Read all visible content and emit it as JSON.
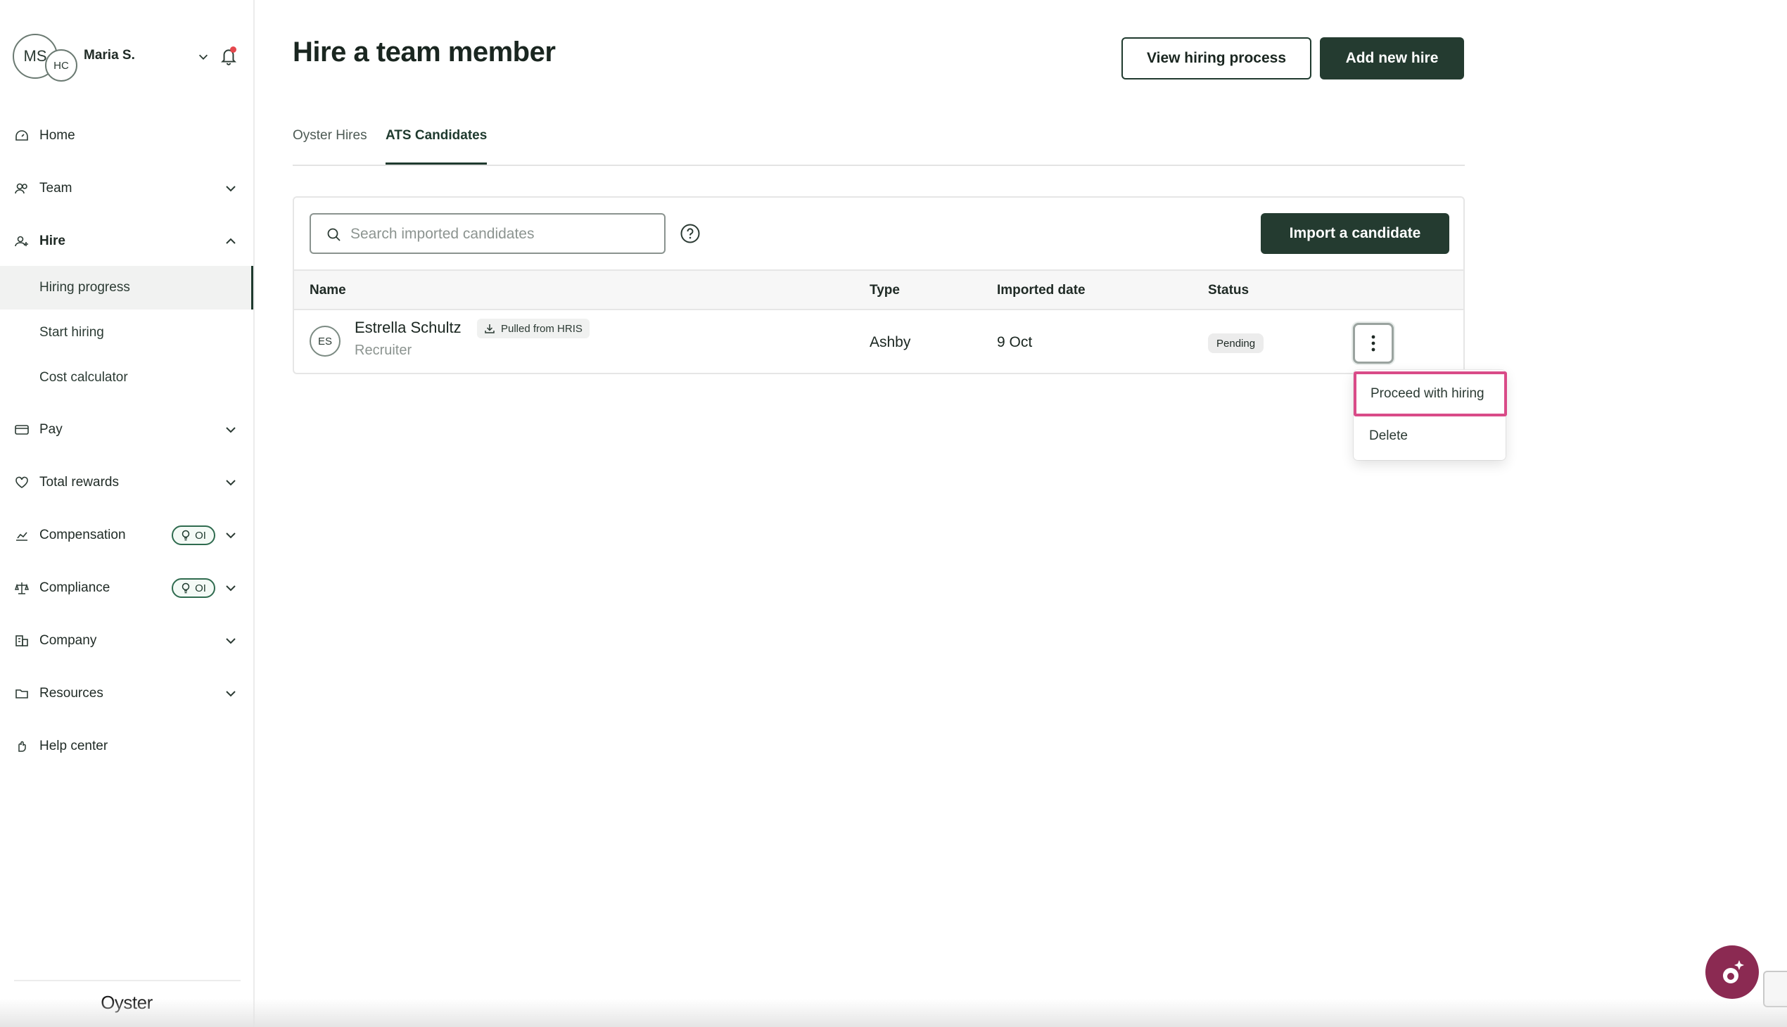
{
  "profile": {
    "initials_primary": "MS",
    "initials_secondary": "HC",
    "name": "Maria S."
  },
  "nav": {
    "home": "Home",
    "team": "Team",
    "hire": "Hire",
    "hire_sub": [
      "Hiring progress",
      "Start hiring",
      "Cost calculator"
    ],
    "pay": "Pay",
    "total_rewards": "Total rewards",
    "compensation": "Compensation",
    "compliance": "Compliance",
    "oi_badge": "OI",
    "company": "Company",
    "resources": "Resources",
    "help_center": "Help center"
  },
  "brand": "Oyster",
  "page": {
    "title": "Hire a team member",
    "view_process_label": "View hiring process",
    "add_new_hire_label": "Add new hire"
  },
  "tabs": [
    {
      "label": "Oyster Hires",
      "active": false
    },
    {
      "label": "ATS Candidates",
      "active": true
    }
  ],
  "search": {
    "placeholder": "Search imported candidates",
    "value": ""
  },
  "import_label": "Import a candidate",
  "table": {
    "headers": [
      "Name",
      "Type",
      "Imported date",
      "Status"
    ],
    "rows": [
      {
        "initials": "ES",
        "name": "Estrella Schultz",
        "badge": "Pulled from HRIS",
        "role": "Recruiter",
        "type": "Ashby",
        "date": "9 Oct",
        "status": "Pending"
      }
    ]
  },
  "row_menu": [
    "Proceed with hiring",
    "Delete"
  ],
  "colors": {
    "primary": "#243b30",
    "accent_highlight": "#d94b88",
    "notification": "#e5484d",
    "fab": "#8b2a52"
  }
}
